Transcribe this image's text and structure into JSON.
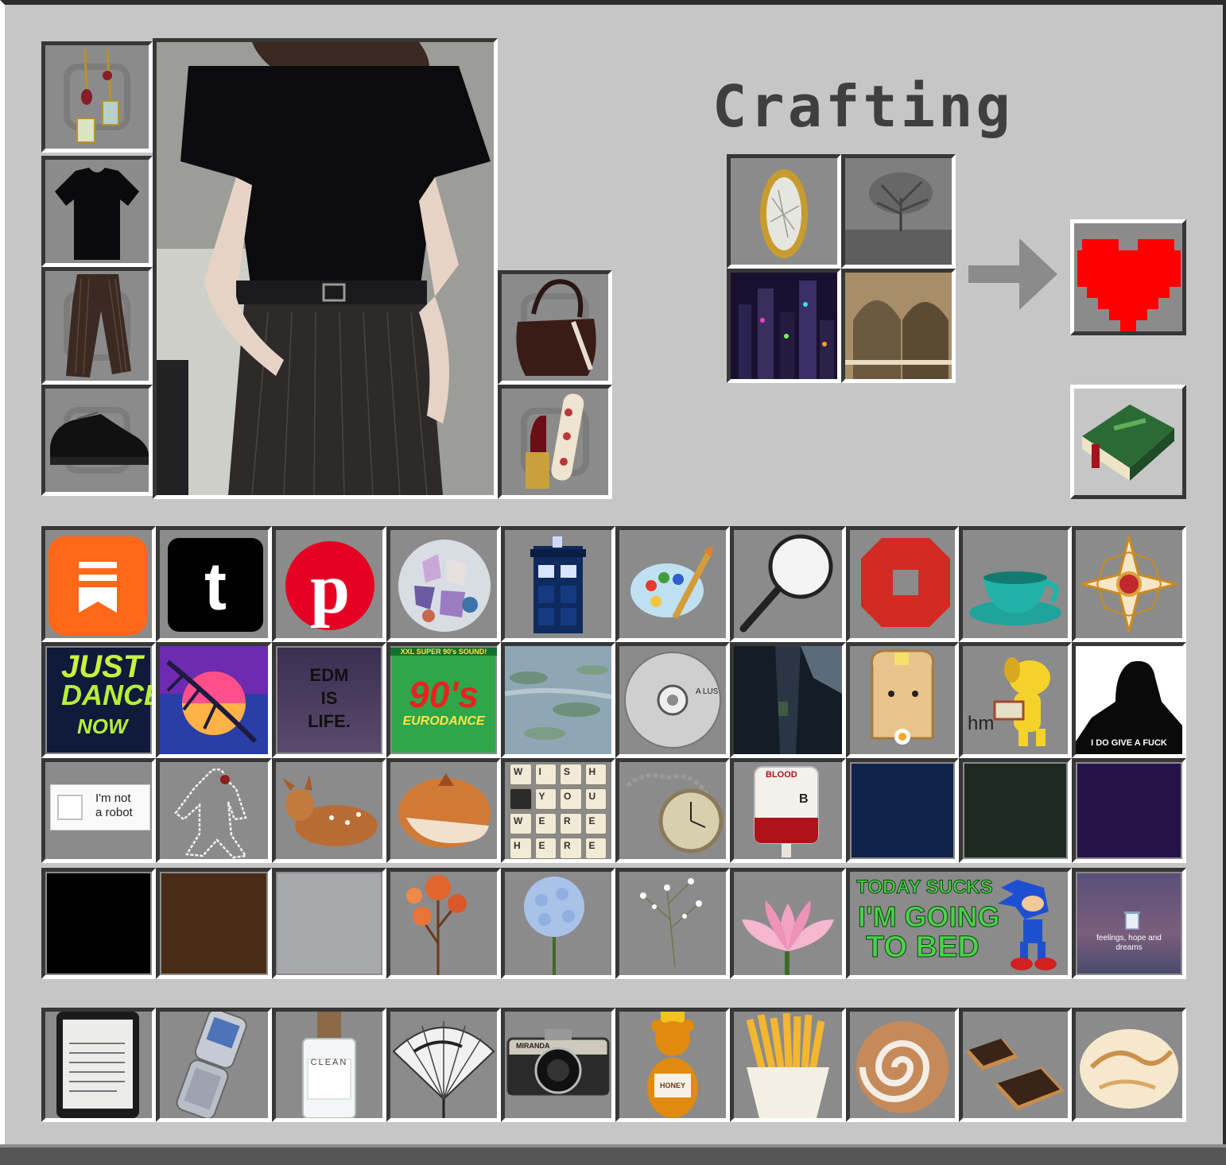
{
  "title": "Crafting",
  "colors": {
    "panel": "#c6c6c6",
    "slot": "#8b8b8b",
    "heart": "#ff0000",
    "navy": "#10244a",
    "dark_green": "#1e2a22",
    "dark_purple": "#26124a",
    "black": "#000000",
    "brown": "#4a2c16",
    "light_grey": "#a7a8ac"
  },
  "equipment": [
    {
      "name": "earrings",
      "icon": "earrings-icon"
    },
    {
      "name": "black t-shirt",
      "icon": "tshirt-icon"
    },
    {
      "name": "pinstripe trousers",
      "icon": "trousers-icon"
    },
    {
      "name": "black shoes",
      "icon": "shoes-icon"
    }
  ],
  "offhand": [
    {
      "name": "handbag",
      "icon": "handbag-icon"
    },
    {
      "name": "lipstick",
      "icon": "lipstick-icon"
    }
  ],
  "crafting_grid": [
    {
      "icon": "mirror-icon"
    },
    {
      "icon": "foggy-tree-icon"
    },
    {
      "icon": "cyber-city-icon"
    },
    {
      "icon": "library-arches-icon"
    }
  ],
  "result": {
    "icon": "pixel-heart-icon"
  },
  "recipe_book": {
    "icon": "recipe-book-icon"
  },
  "inventory": {
    "row1": [
      "substack-icon",
      "tumblr-icon",
      "pinterest-icon",
      "crystals-icon",
      "tardis-icon",
      "paint-palette-icon",
      "magnifier-icon",
      "chase-logo-icon",
      "teacup-icon",
      "brooch-icon"
    ],
    "row2": {
      "just_dance": {
        "line1": "JUST",
        "line2": "DANCE",
        "line3": "NOW"
      },
      "synthwave": {
        "icon": "synthwave-sunset-icon"
      },
      "edm": {
        "text": "EDM\nIS\nLIFE."
      },
      "eurodance": {
        "banner": "XXL SUPER 90's SOUND!",
        "big": "90's",
        "sub": "EURODANCE"
      },
      "monet": {
        "icon": "water-lilies-icon"
      },
      "cd": {
        "text": "A LUS"
      },
      "hallway": {
        "icon": "dark-hallway-icon"
      },
      "toast": {
        "icon": "toast-icon"
      },
      "dog": {
        "caption": "hm"
      },
      "silhouette": {
        "caption": "I DO GIVE A FUCK"
      }
    },
    "row3": {
      "captcha": {
        "text": "I'm not\na robot"
      },
      "keys": [
        "W",
        "I",
        "S",
        "H",
        "",
        "Y",
        "O",
        "U",
        "W",
        "E",
        "R",
        "E",
        "H",
        "E",
        "R",
        "E"
      ],
      "blood": {
        "label": "BLOOD",
        "type": "B"
      }
    },
    "row4": {
      "today_sucks": {
        "line1": "TODAY SUCKS",
        "line2": "I'M GOING",
        "line3": "TO BED"
      },
      "bin": {
        "text": "feelings, hope and dreams"
      }
    }
  },
  "hotbar": [
    "kindle-icon",
    "flip-phone-icon",
    "clean-perfume-icon",
    "hand-fan-icon",
    "miranda-camera-icon",
    "honey-bear-icon",
    "fries-icon",
    "cinnamon-roll-icon",
    "chocolate-biscuits-icon",
    "ice-cream-icon"
  ],
  "hotbar_labels": {
    "camera": "MIRANDA",
    "perfume": "CLEAN",
    "honey": "HONEY"
  }
}
